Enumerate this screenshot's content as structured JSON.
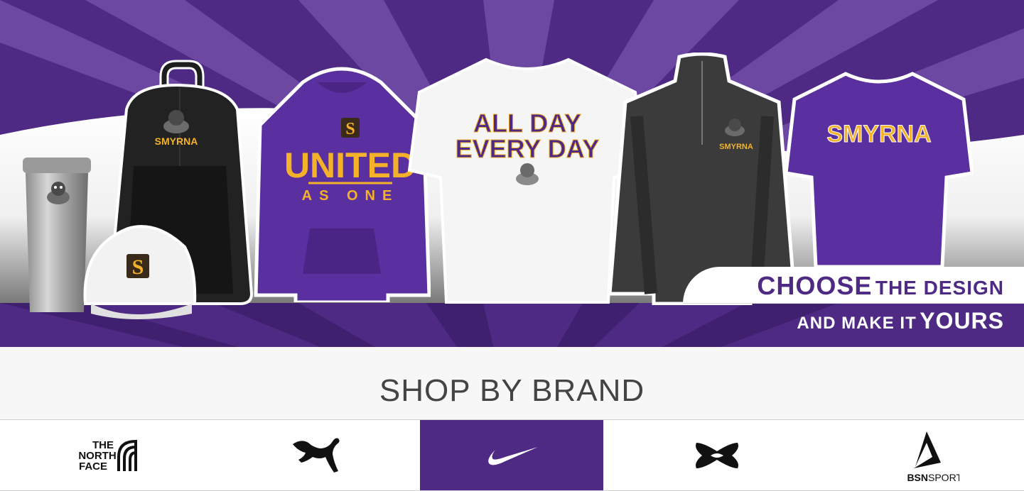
{
  "hero": {
    "colors": {
      "purple": "#4e2a84",
      "purple_light": "#7b57b0",
      "gold": "#f3b229",
      "white": "#ffffff"
    },
    "products": [
      {
        "name": "tumbler",
        "icon": "bulldog-icon"
      },
      {
        "name": "backpack",
        "text": "SMYRNA",
        "icon": "bulldog-icon"
      },
      {
        "name": "cap",
        "icon": "s-logo-icon"
      },
      {
        "name": "hoodie",
        "line1": "UNITED",
        "line2": "AS ONE",
        "icon": "s-logo-icon"
      },
      {
        "name": "tshirt-white",
        "line1": "ALL DAY",
        "line2": "EVERY DAY",
        "icon": "bulldog-icon"
      },
      {
        "name": "quarter-zip",
        "text": "SMYRNA",
        "icon": "bulldog-icon"
      },
      {
        "name": "tshirt-purple",
        "text": "SMYRNA"
      }
    ],
    "tagline": {
      "top_big": "CHOOSE",
      "top_small": "THE DESIGN",
      "bottom_small": "AND MAKE IT",
      "bottom_big": "YOURS"
    }
  },
  "brands": {
    "heading": "SHOP BY BRAND",
    "items": [
      {
        "label": "THE NORTH FACE",
        "line1": "THE",
        "line2": "NORTH",
        "line3": "FACE",
        "icon": "north-face-logo-icon",
        "active": false
      },
      {
        "label": "PUMA",
        "icon": "puma-logo-icon",
        "active": false
      },
      {
        "label": "NIKE",
        "icon": "nike-swoosh-icon",
        "active": true
      },
      {
        "label": "UNDER ARMOUR",
        "icon": "under-armour-logo-icon",
        "active": false
      },
      {
        "label": "BSN SPORTS",
        "text_bold": "BSN",
        "text_regular": "SPORTS",
        "icon": "bsn-sports-logo-icon",
        "active": false
      }
    ]
  }
}
